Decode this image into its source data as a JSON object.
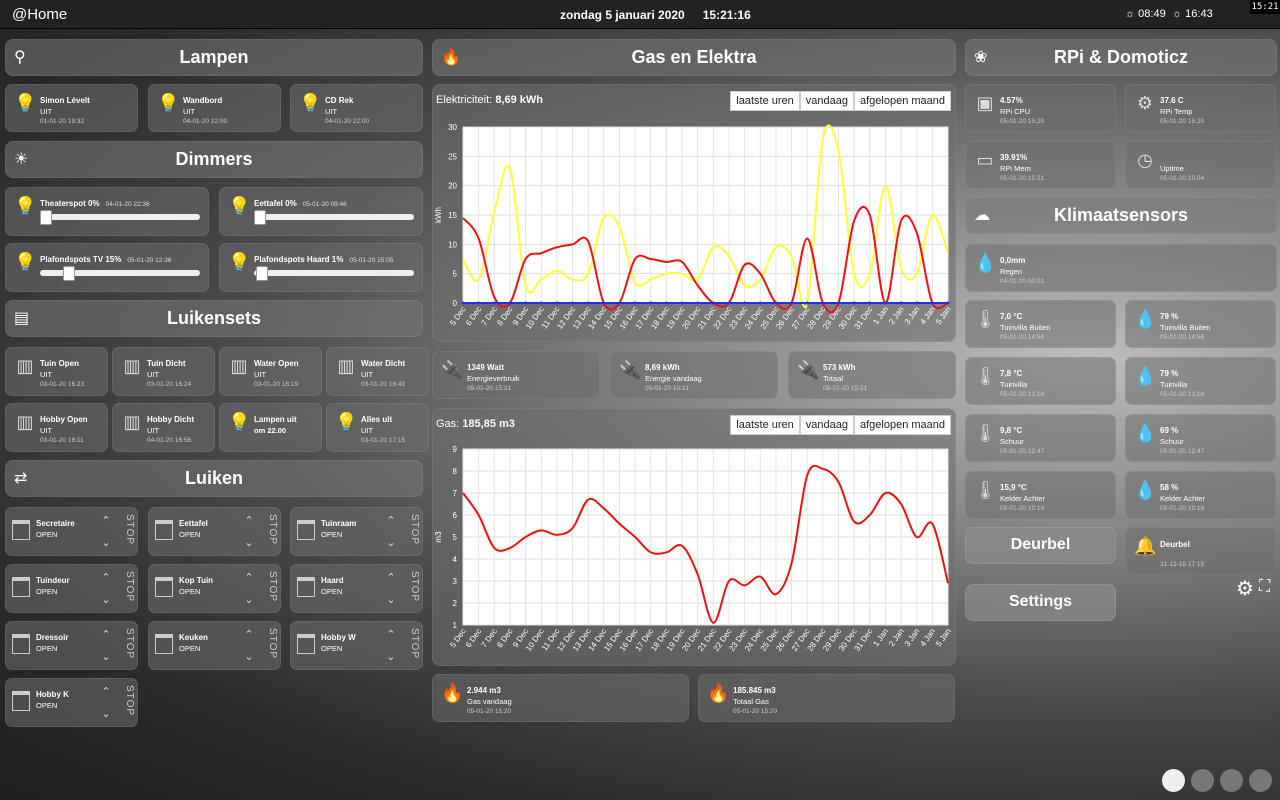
{
  "topbar": {
    "brand": "@Home",
    "date": "zondag 5 januari 2020",
    "time": "15:21:16",
    "sunrise": "08:49",
    "sunset": "16:43",
    "corner_time": "15:21"
  },
  "headers": {
    "lampen": "Lampen",
    "dimmers": "Dimmers",
    "luikensets": "Luikensets",
    "luiken": "Luiken",
    "gas_elektra": "Gas en Elektra",
    "rpi": "RPi & Domoticz",
    "klimaat": "Klimaatsensors"
  },
  "lampen": [
    {
      "name": "Simon Lévelt",
      "state": "UIT",
      "time": "01-01-20 19:32"
    },
    {
      "name": "Wandbord",
      "state": "UIT",
      "time": "04-01-20 22:00"
    },
    {
      "name": "CD Rek",
      "state": "UIT",
      "time": "04-01-20 22:00"
    }
  ],
  "dimmers": [
    {
      "name": "Theaterspot 0%",
      "time": "04-01-20 22:36",
      "level": 0.0
    },
    {
      "name": "Eettafel 0%",
      "time": "05-01-20 09:46",
      "level": 0.0
    },
    {
      "name": "Plafondspots TV 15%",
      "time": "05-01-20 12:36",
      "level": 0.15
    },
    {
      "name": "Plafondspots Haard 1%",
      "time": "05-01-20 15:05",
      "level": 0.01
    }
  ],
  "luikensets": [
    {
      "name": "Tuin Open",
      "state": "UIT",
      "time": "03-01-20 16:23"
    },
    {
      "name": "Tuin Dicht",
      "state": "UIT",
      "time": "03-01-20 16:24"
    },
    {
      "name": "Water Open",
      "state": "UIT",
      "time": "03-01-20 16:19"
    },
    {
      "name": "Water Dicht",
      "state": "UIT",
      "time": "03-01-20 16:43"
    },
    {
      "name": "Hobby Open",
      "state": "UIT",
      "time": "03-01-20 16:11"
    },
    {
      "name": "Hobby Dicht",
      "state": "UIT",
      "time": "04-01-20 16:56"
    },
    {
      "name": "Lampen uit",
      "state": "om 22.00",
      "time": ""
    },
    {
      "name": "Alles uit",
      "state": "UIT",
      "time": "03-01-20 17:15"
    }
  ],
  "luiken": [
    {
      "name": "Secretaire",
      "state": "OPEN"
    },
    {
      "name": "Eettafel",
      "state": "OPEN"
    },
    {
      "name": "Tuinraam",
      "state": "OPEN"
    },
    {
      "name": "Tuindeur",
      "state": "OPEN"
    },
    {
      "name": "Kop Tuin",
      "state": "OPEN"
    },
    {
      "name": "Haard",
      "state": "OPEN"
    },
    {
      "name": "Dressoir",
      "state": "OPEN"
    },
    {
      "name": "Keuken",
      "state": "OPEN"
    },
    {
      "name": "Hobby W",
      "state": "OPEN"
    },
    {
      "name": "Hobby K",
      "state": "OPEN"
    }
  ],
  "stop_label": "STOP",
  "elec": {
    "title": "Elektriciteit:",
    "value": "8,69 kWh",
    "buttons": [
      "laatste uren",
      "vandaag",
      "afgelopen maand"
    ]
  },
  "gas": {
    "title": "Gas:",
    "value": "185,85 m3",
    "buttons": [
      "laatste uren",
      "vandaag",
      "afgelopen maand"
    ]
  },
  "elec_tiles": [
    {
      "value": "1349 Watt",
      "label": "Energieverbruik",
      "time": "05-01-20 15:21"
    },
    {
      "value": "8,69 kWh",
      "label": "Energie vandaag",
      "time": "05-01-20 15:21"
    },
    {
      "value": "573 kWh",
      "label": "Totaal",
      "time": "05-01-20 15:21"
    }
  ],
  "gas_tiles": [
    {
      "value": "2.944 m3",
      "label": "Gas vandaag",
      "time": "05-01-20 15:20"
    },
    {
      "value": "185.845 m3",
      "label": "Totaal Gas",
      "time": "05-01-20 15:20"
    }
  ],
  "rpi": [
    {
      "value": "4.57%",
      "label": "RPi CPU",
      "time": "05-01-20 15:20"
    },
    {
      "value": "37.6 C",
      "label": "RPi Temp",
      "time": "05-01-20 15:20"
    },
    {
      "value": "39.91%",
      "label": "RPi Mem",
      "time": "05-01-20 15:21"
    },
    {
      "value": "",
      "label": "Uptime",
      "time": "05-01-20 15:04"
    }
  ],
  "klimaat": [
    {
      "value": "0,0mm",
      "label": "Regen",
      "time": "04-01-20 00:01"
    },
    {
      "value": "7,0 °C",
      "label": "Tuinvilla Buiten",
      "time": "05-01-20 14:56"
    },
    {
      "value": "79 %",
      "label": "Tuinvilla Buiten",
      "time": "05-01-20 14:56"
    },
    {
      "value": "7,8 °C",
      "label": "Tuinvilla",
      "time": "05-01-20 13:18"
    },
    {
      "value": "79 %",
      "label": "Tuinvilla",
      "time": "05-01-20 13:18"
    },
    {
      "value": "9,8 °C",
      "label": "Schuur",
      "time": "05-01-20 12:47"
    },
    {
      "value": "69 %",
      "label": "Schuur",
      "time": "05-01-20 12:47"
    },
    {
      "value": "15,9 °C",
      "label": "Kelder Achter",
      "time": "05-01-20 10:19"
    },
    {
      "value": "58 %",
      "label": "Kelder Achter",
      "time": "05-01-20 10:19"
    }
  ],
  "buttons": {
    "deurbel": "Deurbel",
    "settings": "Settings"
  },
  "deurbel_tile": {
    "label": "Deurbel",
    "time": "31-12-19 17:15"
  },
  "chart_data": [
    {
      "type": "line",
      "ylabel": "kWh",
      "ylim": [
        0,
        30
      ],
      "grid": true,
      "categories": [
        "5 Dec",
        "6 Dec",
        "7 Dec",
        "8 Dec",
        "9 Dec",
        "10 Dec",
        "11 Dec",
        "12 Dec",
        "13 Dec",
        "14 Dec",
        "15 Dec",
        "16 Dec",
        "17 Dec",
        "18 Dec",
        "19 Dec",
        "20 Dec",
        "21 Dec",
        "22 Dec",
        "23 Dec",
        "24 Dec",
        "25 Dec",
        "26 Dec",
        "27 Dec",
        "28 Dec",
        "29 Dec",
        "30 Dec",
        "31 Dec",
        "1 Jan",
        "2 Jan",
        "3 Jan",
        "4 Jan",
        "5 Jan"
      ],
      "series": [
        {
          "color": "#ffff33",
          "values": [
            7.5,
            4,
            15.5,
            23,
            3,
            4,
            5.5,
            4,
            5,
            14.5,
            13,
            3.5,
            4,
            5,
            5,
            4,
            9.5,
            8,
            3,
            4,
            9.5,
            8,
            0,
            28,
            26,
            5,
            5,
            20,
            6,
            5,
            15,
            8.5
          ]
        },
        {
          "color": "#ee1111",
          "values": [
            14.5,
            11,
            1,
            0,
            7.5,
            8.5,
            9.5,
            10,
            10.5,
            0,
            0,
            7.5,
            7.5,
            7,
            7,
            3,
            0,
            0,
            6.5,
            5,
            0,
            0,
            11,
            0,
            0,
            14,
            15,
            0,
            14,
            12,
            0,
            0
          ]
        },
        {
          "color": "#2233dd",
          "values": [
            0,
            0,
            0,
            0,
            0,
            0,
            0,
            0,
            0,
            0,
            0,
            0,
            0,
            0,
            0,
            0,
            0,
            0,
            0,
            0,
            0,
            0,
            0,
            0,
            0,
            0,
            0,
            0,
            0,
            0,
            0,
            0
          ]
        }
      ]
    },
    {
      "type": "line",
      "ylabel": "m3",
      "ylim": [
        1,
        9
      ],
      "grid": true,
      "categories": [
        "5 Dec",
        "6 Dec",
        "7 Dec",
        "8 Dec",
        "9 Dec",
        "10 Dec",
        "11 Dec",
        "12 Dec",
        "13 Dec",
        "14 Dec",
        "15 Dec",
        "16 Dec",
        "17 Dec",
        "18 Dec",
        "19 Dec",
        "20 Dec",
        "21 Dec",
        "22 Dec",
        "23 Dec",
        "24 Dec",
        "25 Dec",
        "26 Dec",
        "27 Dec",
        "28 Dec",
        "29 Dec",
        "30 Dec",
        "31 Dec",
        "1 Jan",
        "2 Jan",
        "3 Jan",
        "4 Jan",
        "5 Jan"
      ],
      "series": [
        {
          "color": "#ee1111",
          "values": [
            7,
            6,
            4.5,
            4.5,
            5,
            5.3,
            5.1,
            5.4,
            6.7,
            6.3,
            5.6,
            5,
            4.3,
            4.3,
            4.6,
            3.3,
            1.1,
            3,
            2.8,
            3.2,
            2.4,
            3.8,
            7.8,
            8.1,
            7.5,
            5.7,
            6,
            7,
            6.5,
            5,
            5.6,
            2.9
          ]
        }
      ]
    }
  ]
}
